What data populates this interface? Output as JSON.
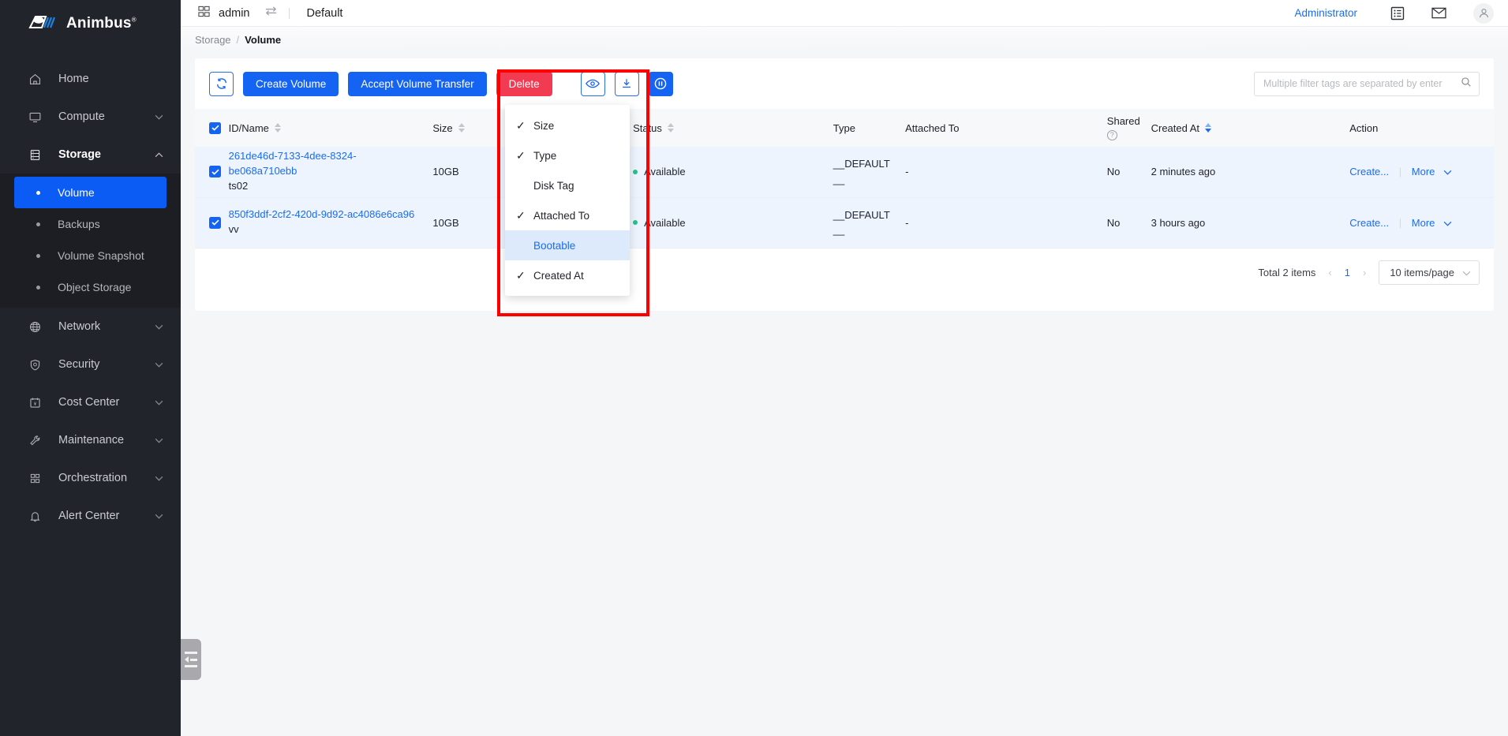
{
  "brand": {
    "name": "Animbus",
    "registered": "®",
    "accent": "#1463f3",
    "sidebar_bg": "#22242b"
  },
  "sidebar": {
    "items": [
      {
        "label": "Home",
        "icon": "home-icon",
        "chevron": ""
      },
      {
        "label": "Compute",
        "icon": "monitor-icon",
        "chevron": "⌄"
      },
      {
        "label": "Storage",
        "icon": "server-icon",
        "chevron": "⌃"
      },
      {
        "label": "Network",
        "icon": "globe-icon",
        "chevron": "⌄"
      },
      {
        "label": "Security",
        "icon": "shield-icon",
        "chevron": "⌄"
      },
      {
        "label": "Cost Center",
        "icon": "calendar-yen-icon",
        "chevron": "⌄"
      },
      {
        "label": "Maintenance",
        "icon": "wrench-icon",
        "chevron": "⌄"
      },
      {
        "label": "Orchestration",
        "icon": "blocks-icon",
        "chevron": "⌄"
      },
      {
        "label": "Alert Center",
        "icon": "bell-icon",
        "chevron": "⌄"
      }
    ],
    "storage_children": [
      {
        "label": "Volume",
        "active": true
      },
      {
        "label": "Backups",
        "active": false
      },
      {
        "label": "Volume Snapshot",
        "active": false
      },
      {
        "label": "Object Storage",
        "active": false
      }
    ]
  },
  "topbar": {
    "project": "admin",
    "environment": "Default",
    "admin_link": "Administrator",
    "swap_icon": "swap-icon",
    "grid_icon": "grid-icon",
    "list_icon": "list-icon",
    "mail_icon": "mail-icon",
    "avatar_icon": "user-avatar-icon"
  },
  "breadcrumb": {
    "parent": "Storage",
    "separator": "/",
    "current": "Volume"
  },
  "toolbar": {
    "refresh_label": "refresh-icon",
    "create_volume": "Create Volume",
    "accept_transfer": "Accept Volume Transfer",
    "delete": "Delete",
    "columns_icon": "eye-icon",
    "export_icon": "download-icon",
    "density_icon": "circle-pause-icon",
    "search_placeholder": "Multiple filter tags are separated by enter",
    "search_value": "",
    "search_icon": "search-icon"
  },
  "column_dropdown": {
    "items": [
      {
        "label": "Size",
        "checked": true,
        "highlighted": false
      },
      {
        "label": "Type",
        "checked": true,
        "highlighted": false
      },
      {
        "label": "Disk Tag",
        "checked": false,
        "highlighted": false
      },
      {
        "label": "Attached To",
        "checked": true,
        "highlighted": false
      },
      {
        "label": "Bootable",
        "checked": false,
        "highlighted": true
      },
      {
        "label": "Created At",
        "checked": true,
        "highlighted": false
      }
    ],
    "check_glyph": "✓"
  },
  "table": {
    "headers": [
      {
        "label": "ID/Name",
        "sortable": true,
        "sort": "none"
      },
      {
        "label": "Size",
        "sortable": true,
        "sort": "none"
      },
      {
        "label": "Status",
        "sortable": true,
        "sort": "none"
      },
      {
        "label": "Type",
        "sortable": false,
        "sort": "none"
      },
      {
        "label": "Attached To",
        "sortable": false,
        "sort": "none"
      },
      {
        "label": "Shared",
        "sortable": false,
        "sort": "none",
        "help": "?"
      },
      {
        "label": "Created At",
        "sortable": true,
        "sort": "desc"
      },
      {
        "label": "Action",
        "sortable": false,
        "sort": "none"
      }
    ],
    "header_checkbox_checked": true,
    "rows": [
      {
        "checked": true,
        "id": "261de46d-7133-4dee-8324-be068a710ebb",
        "name": "ts02",
        "size": "10GB",
        "status": "Available",
        "type": "__DEFAULT__",
        "attached_to": "-",
        "shared": "No",
        "created_at": "2 minutes ago",
        "action_primary": "Create...",
        "action_more": "More"
      },
      {
        "checked": true,
        "id": "850f3ddf-2cf2-420d-9d92-ac4086e6ca96",
        "name": "vv",
        "size": "10GB",
        "status": "Available",
        "type": "__DEFAULT__",
        "attached_to": "-",
        "shared": "No",
        "created_at": "3 hours ago",
        "action_primary": "Create...",
        "action_more": "More"
      }
    ]
  },
  "pagination": {
    "total": "Total 2 items",
    "prev": "‹",
    "page": "1",
    "next": "›",
    "page_size": "10 items/page",
    "chevron": "⌄"
  }
}
